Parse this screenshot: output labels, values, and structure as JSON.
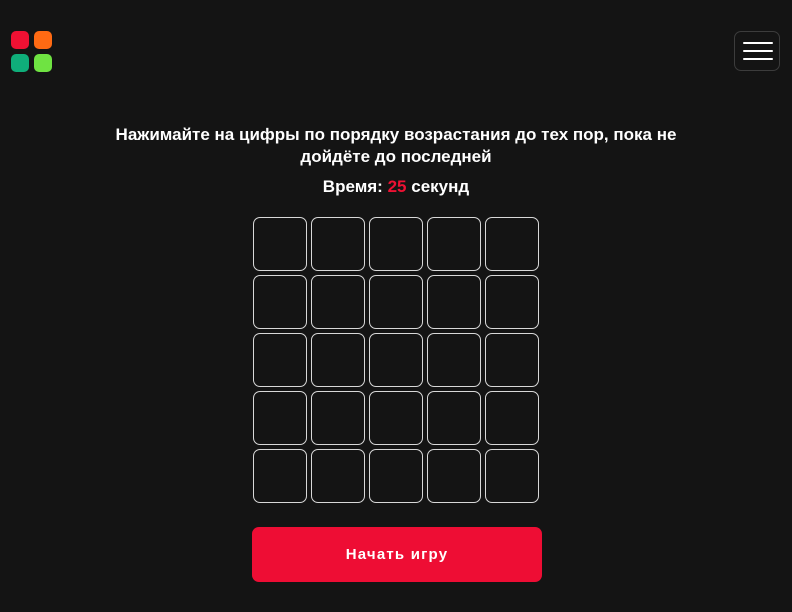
{
  "logo": {
    "colors": [
      "#ee1133",
      "#ff6a13",
      "#0fae7a",
      "#6fe342"
    ],
    "icon": "app-grid-logo"
  },
  "header": {
    "menu_icon": "hamburger-icon"
  },
  "game": {
    "instruction": "Нажимайте на цифры по порядку возрастания до тех пор, пока не дойдёте до последней",
    "timer_label": "Время:",
    "timer_value": "25",
    "timer_unit": "секунд",
    "grid_rows": 5,
    "grid_cols": 5,
    "accent_color": "#ee1133"
  },
  "actions": {
    "start_label": "Начать игру",
    "start_color": "#ee0d34"
  }
}
